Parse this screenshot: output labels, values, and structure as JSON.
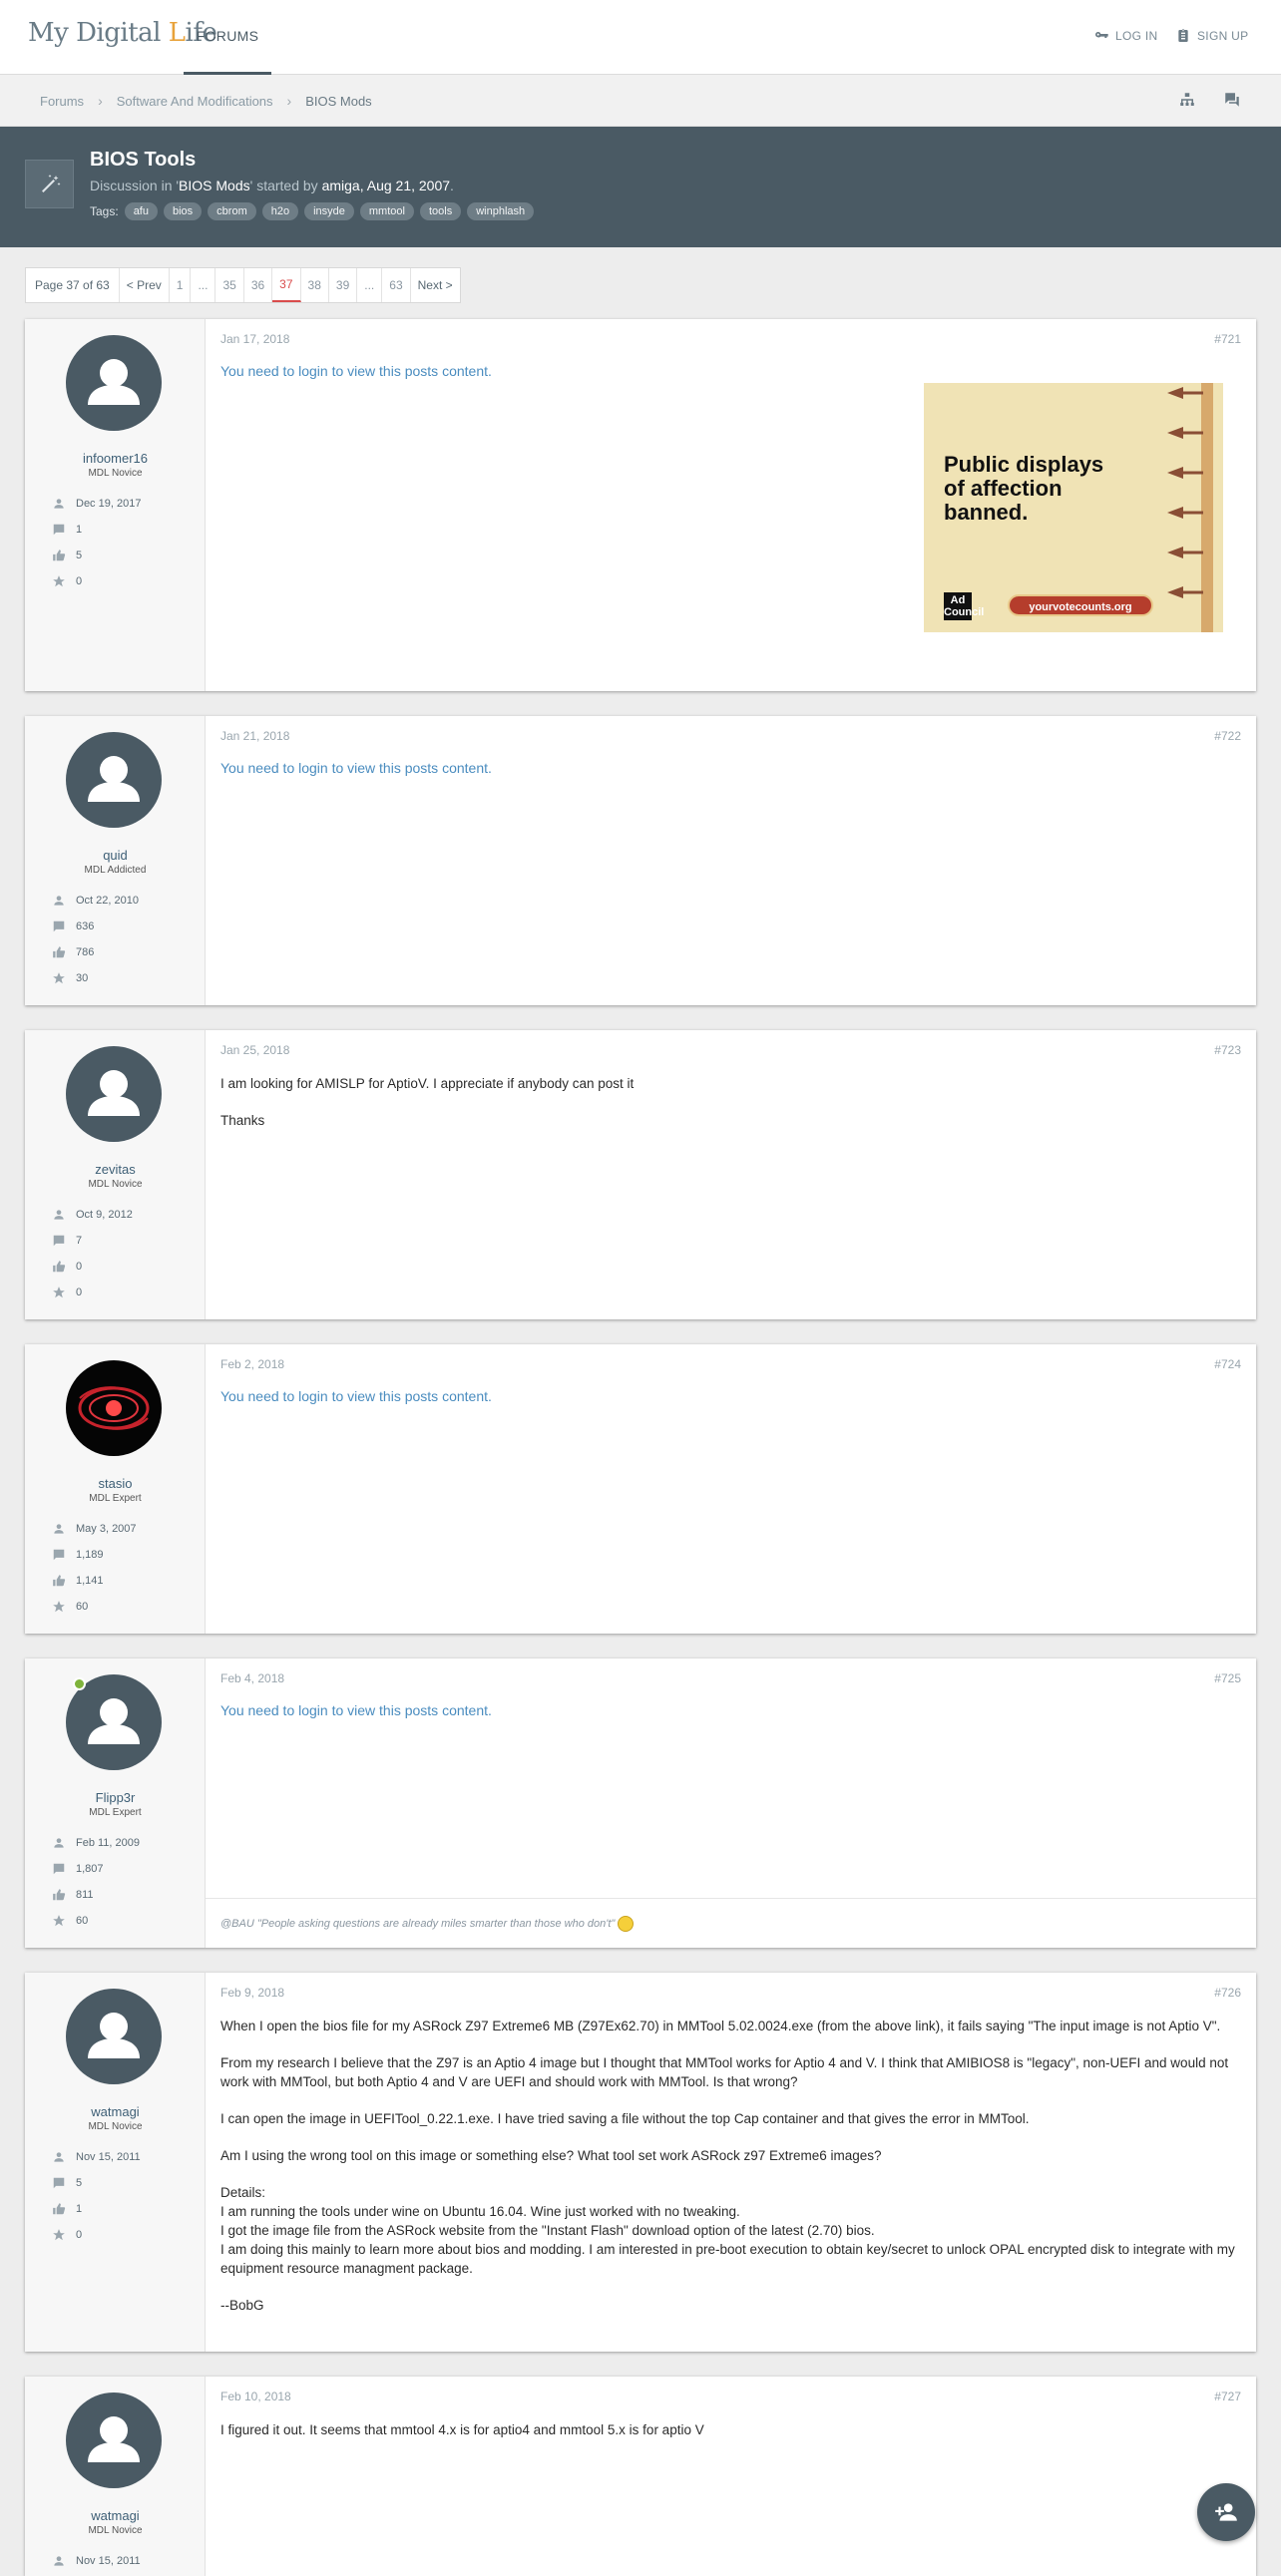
{
  "header": {
    "logo": {
      "text_a": "My Digital ",
      "text_b": "L",
      "text_c": "ife"
    },
    "nav_forums": "FORUMS",
    "login": "LOG IN",
    "signup": "SIGN UP"
  },
  "breadcrumb": {
    "items": [
      "Forums",
      "Software And Modifications",
      "BIOS Mods"
    ]
  },
  "thread": {
    "title": "BIOS Tools",
    "meta_prefix": "Discussion in '",
    "meta_forum": "BIOS Mods",
    "meta_mid": "' started by ",
    "meta_author": "amiga",
    "meta_sep": ", ",
    "meta_date": "Aug 21, 2007",
    "meta_end": ".",
    "tags_label": "Tags:",
    "tags": [
      "afu",
      "bios",
      "cbrom",
      "h2o",
      "insyde",
      "mmtool",
      "tools",
      "winphlash"
    ]
  },
  "pagination": {
    "label": "Page 37 of 63",
    "prev": "< Prev",
    "pages": [
      "1",
      "...",
      "35",
      "36",
      "37",
      "38",
      "39",
      "...",
      "63"
    ],
    "current": "37",
    "next": "Next >"
  },
  "login_msg": "You need to login to view this posts content.",
  "ad": {
    "headline_1": "Public displays",
    "headline_2": "of affection",
    "headline_3": "banned.",
    "logo": "Ad Council",
    "url": "yourvotecounts.org"
  },
  "posts": [
    {
      "user": "infoomer16",
      "title": "MDL Novice",
      "joined": "Dec 19, 2017",
      "messages": "1",
      "likes": "5",
      "points": "0",
      "date": "Jan 17, 2018",
      "num": "#721"
    },
    {
      "user": "quid",
      "title": "MDL Addicted",
      "joined": "Oct 22, 2010",
      "messages": "636",
      "likes": "786",
      "points": "30",
      "date": "Jan 21, 2018",
      "num": "#722"
    },
    {
      "user": "zevitas",
      "title": "MDL Novice",
      "joined": "Oct 9, 2012",
      "messages": "7",
      "likes": "0",
      "points": "0",
      "date": "Jan 25, 2018",
      "num": "#723",
      "body": [
        "I am looking for AMISLP for AptioV. I appreciate if anybody can post it",
        "Thanks"
      ]
    },
    {
      "user": "stasio",
      "title": "MDL Expert",
      "joined": "May 3, 2007",
      "messages": "1,189",
      "likes": "1,141",
      "points": "60",
      "date": "Feb 2, 2018",
      "num": "#724"
    },
    {
      "user": "Flipp3r",
      "title": "MDL Expert",
      "joined": "Feb 11, 2009",
      "messages": "1,807",
      "likes": "811",
      "points": "60",
      "date": "Feb 4, 2018",
      "num": "#725",
      "signature": "@BAU \"People asking questions are already miles smarter than those who don't\""
    },
    {
      "user": "watmagi",
      "title": "MDL Novice",
      "joined": "Nov 15, 2011",
      "messages": "5",
      "likes": "1",
      "points": "0",
      "date": "Feb 9, 2018",
      "num": "#726",
      "body": [
        "When I open the bios file for my ASRock Z97 Extreme6 MB (Z97Ex62.70) in MMTool 5.02.0024.exe (from the above link), it fails saying \"The input image is not Aptio V\".",
        "From my research I believe that the Z97 is an Aptio 4 image but I thought that MMTool works for Aptio 4 and V. I think that AMIBIOS8 is \"legacy\", non-UEFI and would not work with MMTool, but both Aptio 4 and V are UEFI and should work with MMTool. Is that wrong?",
        "I can open the image in UEFITool_0.22.1.exe. I have tried saving a file without the top Cap container and that gives the error in MMTool.",
        "Am I using the wrong tool on this image or something else? What tool set work ASRock z97 Extreme6 images?",
        "Details:\nI am running the tools under wine on Ubuntu 16.04. Wine just worked with no tweaking.\nI got the image file from the ASRock website from the \"Instant Flash\" download option of the latest (2.70) bios.\nI am doing this mainly to learn more about bios and modding. I am interested in pre-boot execution to obtain key/secret to unlock OPAL encrypted disk to integrate with my equipment resource managment package.",
        "--BobG"
      ]
    },
    {
      "user": "watmagi",
      "title": "MDL Novice",
      "joined": "Nov 15, 2011",
      "date": "Feb 10, 2018",
      "num": "#727",
      "body": [
        "I figured it out. It seems that mmtool 4.x is for aptio4 and mmtool 5.x is for aptio V"
      ]
    }
  ]
}
